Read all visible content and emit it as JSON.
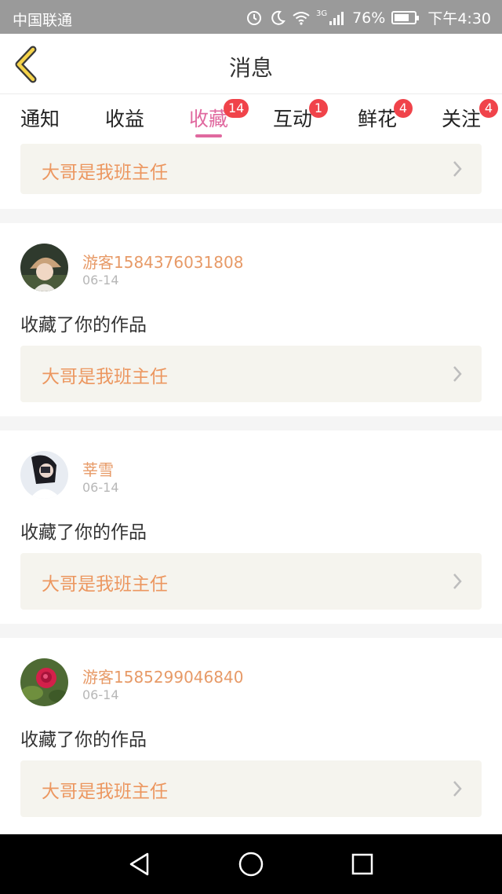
{
  "status_bar": {
    "carrier": "中国联通",
    "network": "3G",
    "battery": "76%",
    "battery_level": 0.76,
    "time": "下午4:30",
    "icons": [
      "alarm-icon",
      "moon-icon",
      "wifi-icon",
      "signal-icon",
      "battery-icon"
    ]
  },
  "header": {
    "title": "消息",
    "back_icon": "chevron-left-icon"
  },
  "tabs": [
    {
      "label": "通知",
      "badge": "",
      "active": false
    },
    {
      "label": "收益",
      "badge": "",
      "active": false
    },
    {
      "label": "收藏",
      "badge": "14",
      "active": true
    },
    {
      "label": "互动",
      "badge": "1",
      "active": false
    },
    {
      "label": "鲜花",
      "badge": "4",
      "active": false
    },
    {
      "label": "关注",
      "badge": "4",
      "active": false
    }
  ],
  "feed": {
    "partial_top_item": {
      "work_title": "大哥是我班主任"
    },
    "items": [
      {
        "user": "游客1584376031808",
        "date": "06-14",
        "action": "收藏了你的作品",
        "work_title": "大哥是我班主任",
        "avatar": "avatar-girl-hat"
      },
      {
        "user": "莘雪",
        "date": "06-14",
        "action": "收藏了你的作品",
        "work_title": "大哥是我班主任",
        "avatar": "avatar-girl-dark"
      },
      {
        "user": "游客1585299046840",
        "date": "06-14",
        "action": "收藏了你的作品",
        "work_title": "大哥是我班主任",
        "avatar": "avatar-red-rose"
      }
    ]
  },
  "nav_bar": {
    "buttons": [
      "back-triangle-icon",
      "home-circle-icon",
      "recents-square-icon"
    ]
  },
  "colors": {
    "accent": "#e0699f",
    "badge": "#f0434a",
    "work_title": "#ec9760",
    "username": "#e79a67",
    "status_bar_bg": "#9a9a9a"
  }
}
